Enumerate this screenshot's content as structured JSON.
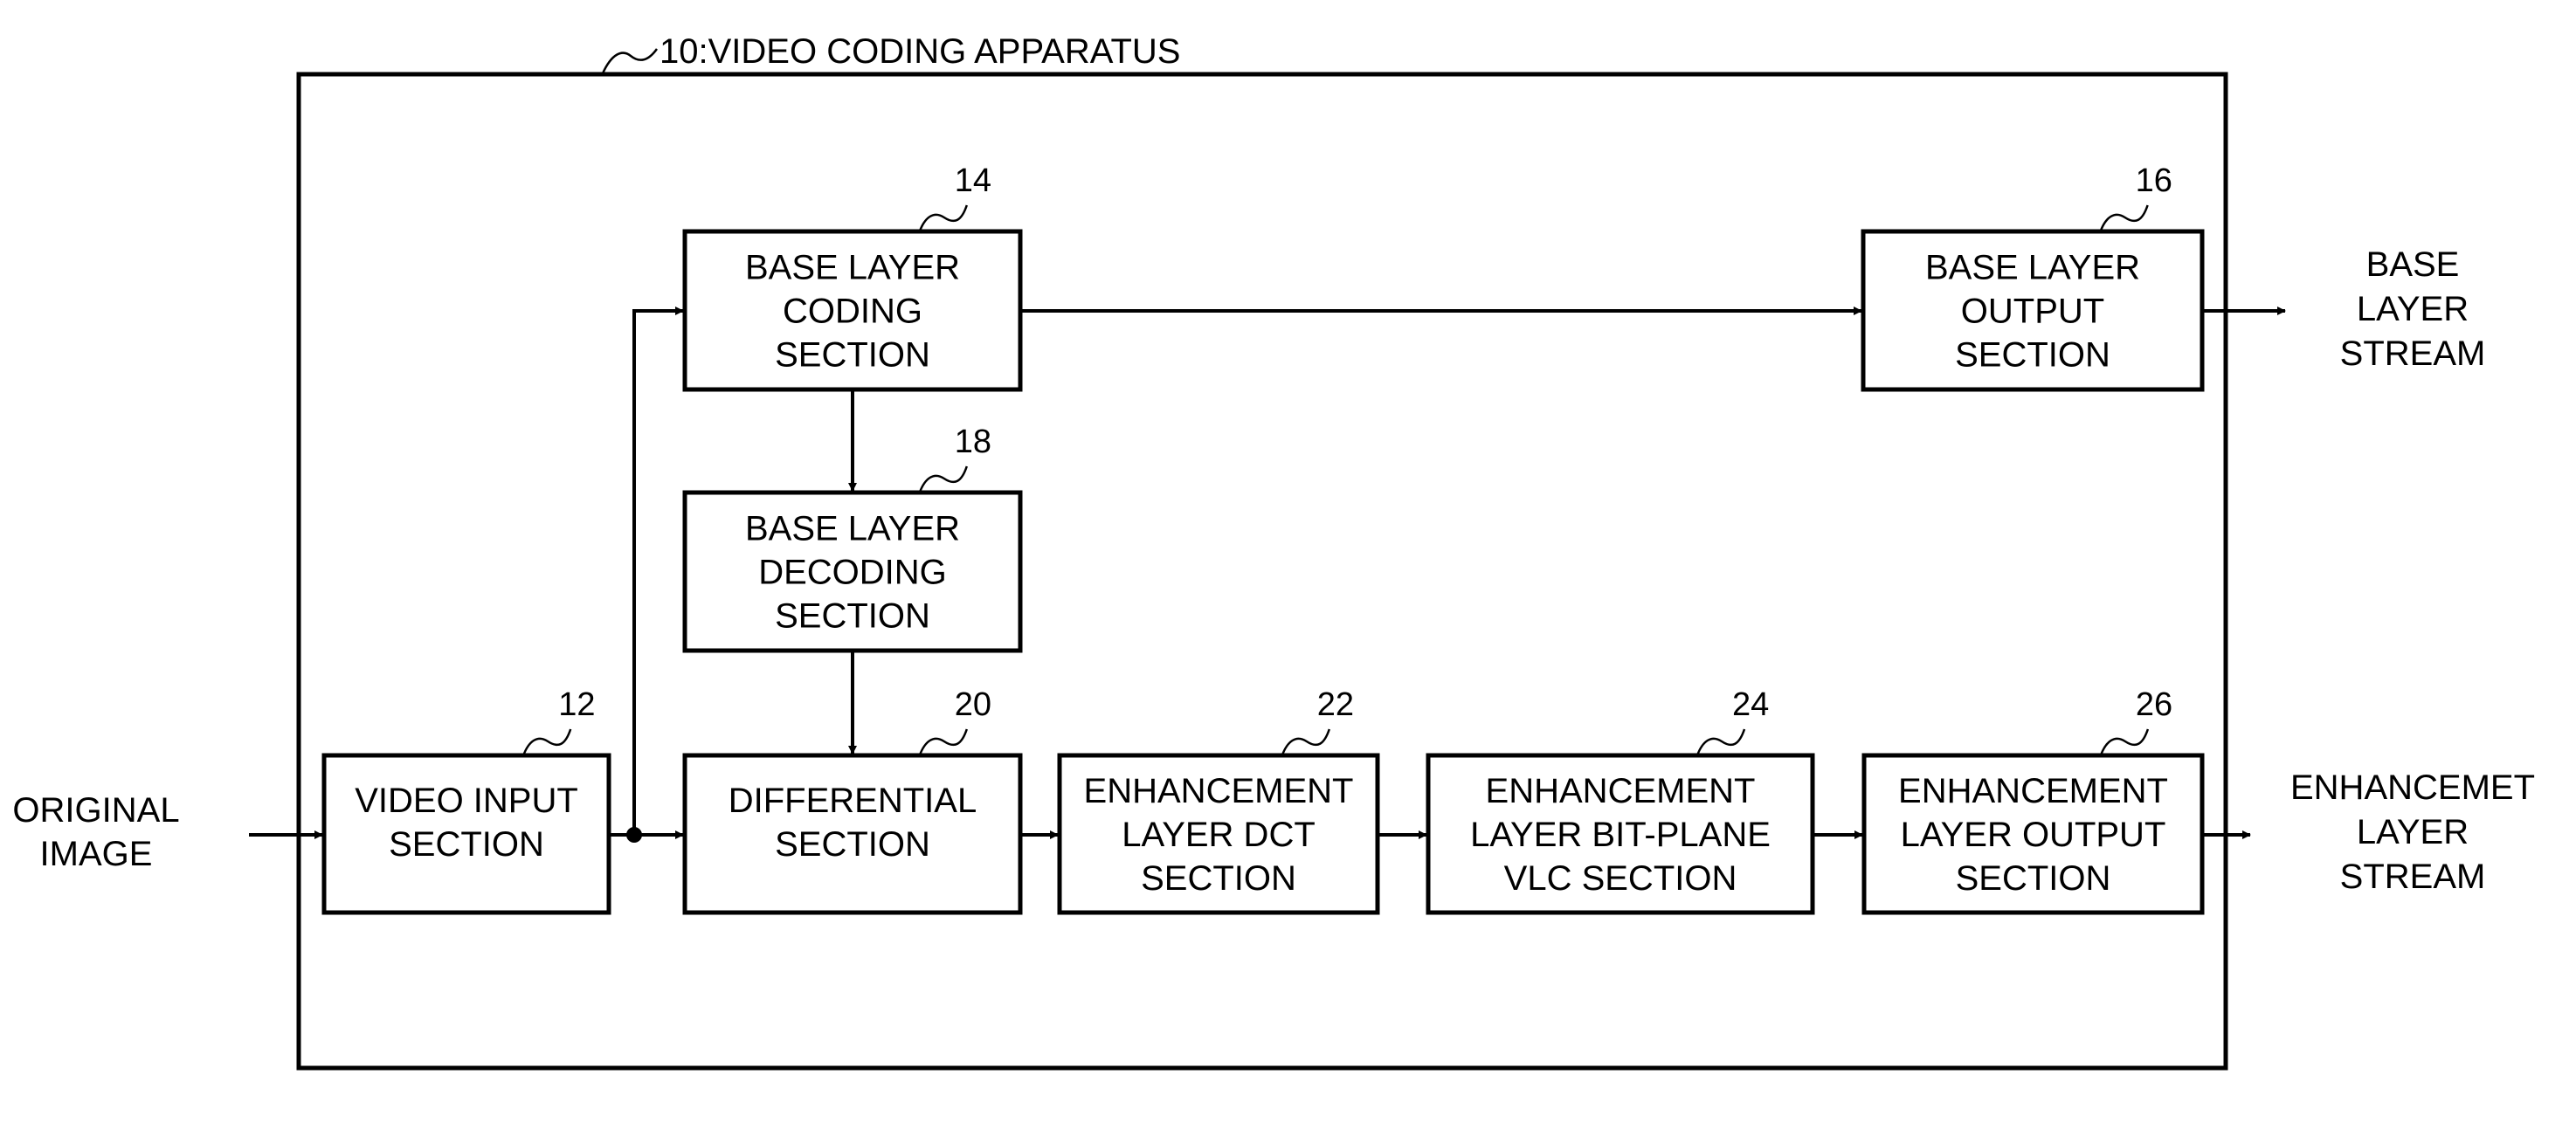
{
  "diagram": {
    "title": {
      "ref": "10",
      "label": "10:VIDEO CODING APPARATUS"
    },
    "colors": {
      "ink": "#000000",
      "paper": "#ffffff"
    },
    "blocks": [
      {
        "id": "b12",
        "ref": "12",
        "lines": [
          "VIDEO INPUT",
          "SECTION"
        ]
      },
      {
        "id": "b14",
        "ref": "14",
        "lines": [
          "BASE LAYER",
          "CODING",
          "SECTION"
        ]
      },
      {
        "id": "b16",
        "ref": "16",
        "lines": [
          "BASE LAYER",
          "OUTPUT",
          "SECTION"
        ]
      },
      {
        "id": "b18",
        "ref": "18",
        "lines": [
          "BASE LAYER",
          "DECODING",
          "SECTION"
        ]
      },
      {
        "id": "b20",
        "ref": "20",
        "lines": [
          "DIFFERENTIAL",
          "SECTION"
        ]
      },
      {
        "id": "b22",
        "ref": "22",
        "lines": [
          "ENHANCEMENT",
          "LAYER DCT",
          "SECTION"
        ]
      },
      {
        "id": "b24",
        "ref": "24",
        "lines": [
          "ENHANCEMENT",
          "LAYER BIT-PLANE",
          "VLC SECTION"
        ]
      },
      {
        "id": "b26",
        "ref": "26",
        "lines": [
          "ENHANCEMENT",
          "LAYER OUTPUT",
          "SECTION"
        ]
      }
    ],
    "io_labels": {
      "input": [
        "ORIGINAL",
        "IMAGE"
      ],
      "base_output": [
        "BASE",
        "LAYER",
        "STREAM"
      ],
      "enh_output": [
        "ENHANCEMET",
        "LAYER",
        "STREAM"
      ]
    },
    "connections": [
      {
        "from": "input",
        "to": "b12"
      },
      {
        "from": "b12",
        "to": "b20"
      },
      {
        "from": "b12",
        "to": "b14"
      },
      {
        "from": "b14",
        "to": "b16"
      },
      {
        "from": "b14",
        "to": "b18"
      },
      {
        "from": "b18",
        "to": "b20"
      },
      {
        "from": "b20",
        "to": "b22"
      },
      {
        "from": "b22",
        "to": "b24"
      },
      {
        "from": "b24",
        "to": "b26"
      },
      {
        "from": "b16",
        "to": "base_output"
      },
      {
        "from": "b26",
        "to": "enh_output"
      }
    ]
  }
}
